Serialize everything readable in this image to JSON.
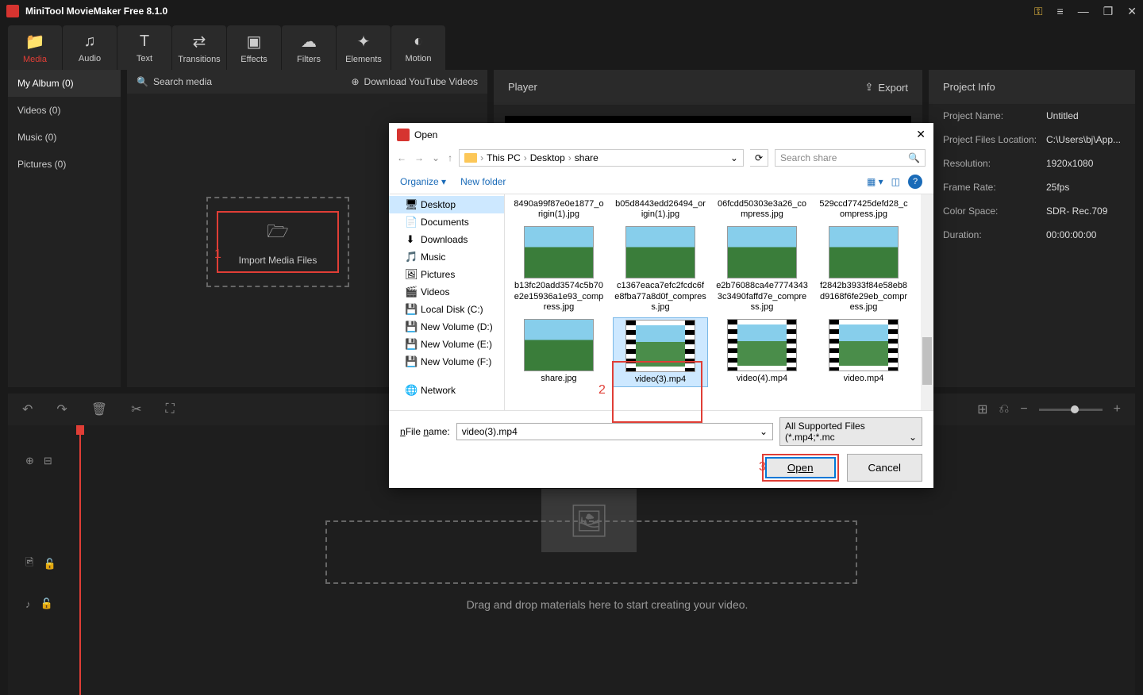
{
  "titlebar": {
    "title": "MiniTool MovieMaker Free 8.1.0"
  },
  "toolbar": {
    "items": [
      {
        "label": "Media"
      },
      {
        "label": "Audio"
      },
      {
        "label": "Text"
      },
      {
        "label": "Transitions"
      },
      {
        "label": "Effects"
      },
      {
        "label": "Filters"
      },
      {
        "label": "Elements"
      },
      {
        "label": "Motion"
      }
    ]
  },
  "sidebar": {
    "items": [
      {
        "label": "My Album (0)"
      },
      {
        "label": "Videos (0)"
      },
      {
        "label": "Music (0)"
      },
      {
        "label": "Pictures (0)"
      }
    ]
  },
  "media": {
    "search_placeholder": "Search media",
    "download_link": "Download YouTube Videos",
    "import_label": "Import Media Files"
  },
  "player": {
    "title": "Player",
    "export": "Export"
  },
  "info": {
    "title": "Project Info",
    "rows": [
      {
        "label": "Project Name:",
        "value": "Untitled"
      },
      {
        "label": "Project Files Location:",
        "value": "C:\\Users\\bj\\App..."
      },
      {
        "label": "Resolution:",
        "value": "1920x1080"
      },
      {
        "label": "Frame Rate:",
        "value": "25fps"
      },
      {
        "label": "Color Space:",
        "value": "SDR- Rec.709"
      },
      {
        "label": "Duration:",
        "value": "00:00:00:00"
      }
    ]
  },
  "timeline": {
    "drop_hint": "Drag and drop materials here to start creating your video."
  },
  "annotations": {
    "one": "1",
    "two": "2",
    "three": "3"
  },
  "dialog": {
    "title": "Open",
    "breadcrumb": [
      "This PC",
      "Desktop",
      "share"
    ],
    "search_placeholder": "Search share",
    "organize": "Organize",
    "new_folder": "New folder",
    "tree": [
      {
        "label": "Desktop",
        "icon": "🖥",
        "selected": true
      },
      {
        "label": "Documents",
        "icon": "📄"
      },
      {
        "label": "Downloads",
        "icon": "⬇"
      },
      {
        "label": "Music",
        "icon": "🎵"
      },
      {
        "label": "Pictures",
        "icon": "🖼"
      },
      {
        "label": "Videos",
        "icon": "🎬"
      },
      {
        "label": "Local Disk (C:)",
        "icon": "💾"
      },
      {
        "label": "New Volume (D:)",
        "icon": "💾"
      },
      {
        "label": "New Volume (E:)",
        "icon": "💾"
      },
      {
        "label": "New Volume (F:)",
        "icon": "💾"
      },
      {
        "label": "Network",
        "icon": "🌐"
      }
    ],
    "files": [
      {
        "name": "8490a99f87e0e1877_origin(1).jpg",
        "type": "img",
        "noimg": true
      },
      {
        "name": "b05d8443edd26494_origin(1).jpg",
        "type": "img",
        "noimg": true
      },
      {
        "name": "06fcdd50303e3a26_compress.jpg",
        "type": "img",
        "noimg": true
      },
      {
        "name": "529ccd77425defd28_compress.jpg",
        "type": "img",
        "noimg": true
      },
      {
        "name": "b13fc20add3574c5b70e2e15936a1e93_compress.jpg",
        "type": "img"
      },
      {
        "name": "c1367eaca7efc2fcdc6fe8fba77a8d0f_compress.jpg",
        "type": "img"
      },
      {
        "name": "e2b76088ca4e77743433c3490faffd7e_compress.jpg",
        "type": "img"
      },
      {
        "name": "f2842b3933f84e58eb8d9168f6fe29eb_compress.jpg",
        "type": "img"
      },
      {
        "name": "share.jpg",
        "type": "img"
      },
      {
        "name": "video(3).mp4",
        "type": "video",
        "selected": true
      },
      {
        "name": "video(4).mp4",
        "type": "video"
      },
      {
        "name": "video.mp4",
        "type": "video"
      }
    ],
    "filename_label": "File name:",
    "filename_value": "video(3).mp4",
    "filter": "All Supported Files (*.mp4;*.mc",
    "open_btn": "Open",
    "cancel_btn": "Cancel"
  }
}
